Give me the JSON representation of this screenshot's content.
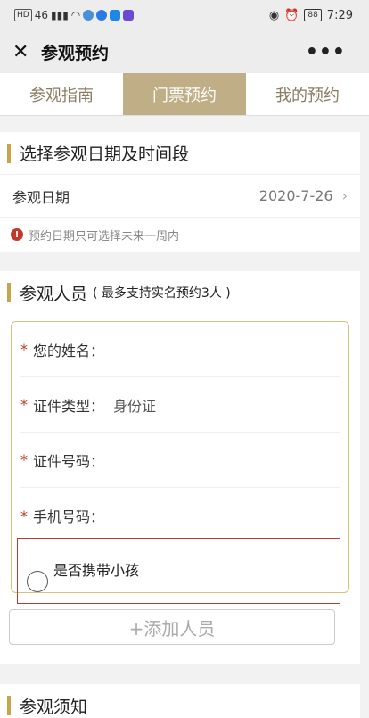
{
  "status": {
    "left_chip": "HD",
    "signal": "46",
    "time": "7:29",
    "battery": "88"
  },
  "nav": {
    "title": "参观预约"
  },
  "tabs": [
    {
      "label": "参观指南"
    },
    {
      "label": "门票预约"
    },
    {
      "label": "我的预约"
    }
  ],
  "date_section": {
    "title": "选择参观日期及时间段",
    "date_label": "参观日期",
    "date_value": "2020-7-26",
    "notice": "预约日期只可选择未来一周内"
  },
  "person_section": {
    "title": "参观人员",
    "subtitle": "( 最多支持实名预约3人 )",
    "fields": [
      {
        "label": "您的姓名：",
        "value": ""
      },
      {
        "label": "证件类型：",
        "value": "身份证"
      },
      {
        "label": "证件号码：",
        "value": ""
      },
      {
        "label": "手机号码：",
        "value": ""
      }
    ],
    "child_label": "是否携带小孩",
    "add_button": "+添加人员"
  },
  "notice_section": {
    "title": "参观须知"
  },
  "colors": {
    "accent": "#c8a548",
    "tab_active": "#bfae86",
    "required": "#c0392b"
  }
}
